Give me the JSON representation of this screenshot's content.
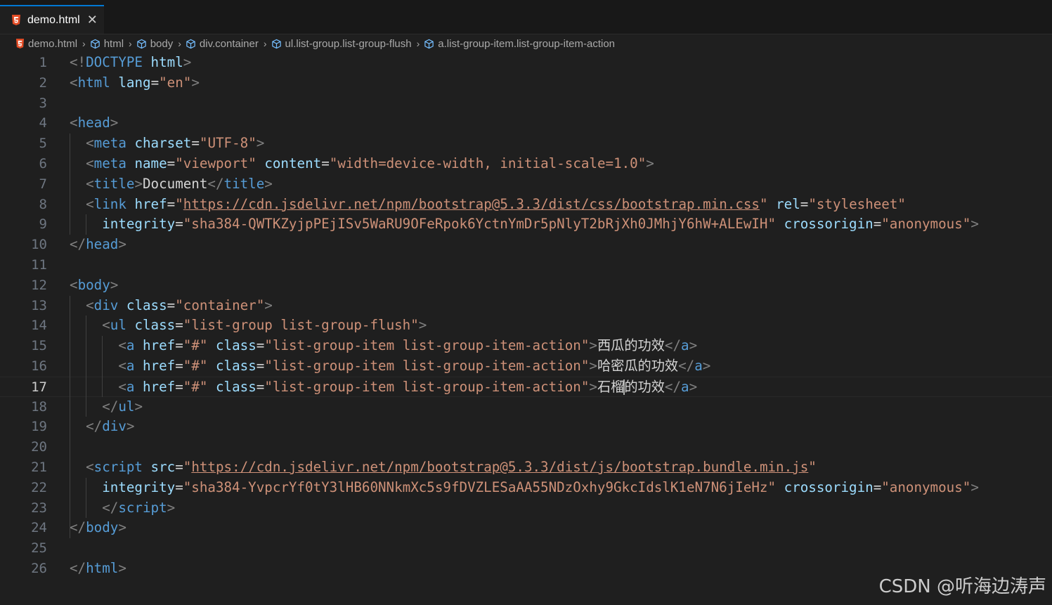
{
  "tab": {
    "filename": "demo.html",
    "close": "✕"
  },
  "breadcrumbs": [
    "demo.html",
    "html",
    "body",
    "div.container",
    "ul.list-group.list-group-flush",
    "a.list-group-item.list-group-item-action"
  ],
  "editor": {
    "active_line": 17,
    "line_numbers": [
      "1",
      "2",
      "3",
      "4",
      "5",
      "6",
      "7",
      "8",
      "9",
      "10",
      "11",
      "12",
      "13",
      "14",
      "15",
      "16",
      "17",
      "18",
      "19",
      "20",
      "21",
      "22",
      "23",
      "24",
      "25",
      "26"
    ],
    "lines": [
      [
        [
          "p",
          "<!"
        ],
        [
          "t",
          "DOCTYPE"
        ],
        [
          "x",
          " "
        ],
        [
          "a",
          "html"
        ],
        [
          "p",
          ">"
        ]
      ],
      [
        [
          "p",
          "<"
        ],
        [
          "t",
          "html"
        ],
        [
          "x",
          " "
        ],
        [
          "a",
          "lang"
        ],
        [
          "x",
          "="
        ],
        [
          "s",
          "\"en\""
        ],
        [
          "p",
          ">"
        ]
      ],
      [],
      [
        [
          "p",
          "<"
        ],
        [
          "t",
          "head"
        ],
        [
          "p",
          ">"
        ]
      ],
      [
        [
          "x",
          "  "
        ],
        [
          "p",
          "<"
        ],
        [
          "t",
          "meta"
        ],
        [
          "x",
          " "
        ],
        [
          "a",
          "charset"
        ],
        [
          "x",
          "="
        ],
        [
          "s",
          "\"UTF-8\""
        ],
        [
          "p",
          ">"
        ]
      ],
      [
        [
          "x",
          "  "
        ],
        [
          "p",
          "<"
        ],
        [
          "t",
          "meta"
        ],
        [
          "x",
          " "
        ],
        [
          "a",
          "name"
        ],
        [
          "x",
          "="
        ],
        [
          "s",
          "\"viewport\""
        ],
        [
          "x",
          " "
        ],
        [
          "a",
          "content"
        ],
        [
          "x",
          "="
        ],
        [
          "s",
          "\"width=device-width, initial-scale=1.0\""
        ],
        [
          "p",
          ">"
        ]
      ],
      [
        [
          "x",
          "  "
        ],
        [
          "p",
          "<"
        ],
        [
          "t",
          "title"
        ],
        [
          "p",
          ">"
        ],
        [
          "x",
          "Document"
        ],
        [
          "p",
          "</"
        ],
        [
          "t",
          "title"
        ],
        [
          "p",
          ">"
        ]
      ],
      [
        [
          "x",
          "  "
        ],
        [
          "p",
          "<"
        ],
        [
          "t",
          "link"
        ],
        [
          "x",
          " "
        ],
        [
          "a",
          "href"
        ],
        [
          "x",
          "="
        ],
        [
          "s",
          "\""
        ],
        [
          "u",
          "https://cdn.jsdelivr.net/npm/bootstrap@5.3.3/dist/css/bootstrap.min.css"
        ],
        [
          "s",
          "\""
        ],
        [
          "x",
          " "
        ],
        [
          "a",
          "rel"
        ],
        [
          "x",
          "="
        ],
        [
          "s",
          "\"stylesheet\""
        ]
      ],
      [
        [
          "x",
          "    "
        ],
        [
          "a",
          "integrity"
        ],
        [
          "x",
          "="
        ],
        [
          "s",
          "\"sha384-QWTKZyjpPEjISv5WaRU9OFeRpok6YctnYmDr5pNlyT2bRjXh0JMhjY6hW+ALEwIH\""
        ],
        [
          "x",
          " "
        ],
        [
          "a",
          "crossorigin"
        ],
        [
          "x",
          "="
        ],
        [
          "s",
          "\"anonymous\""
        ],
        [
          "p",
          ">"
        ]
      ],
      [
        [
          "p",
          "</"
        ],
        [
          "t",
          "head"
        ],
        [
          "p",
          ">"
        ]
      ],
      [],
      [
        [
          "p",
          "<"
        ],
        [
          "t",
          "body"
        ],
        [
          "p",
          ">"
        ]
      ],
      [
        [
          "x",
          "  "
        ],
        [
          "p",
          "<"
        ],
        [
          "t",
          "div"
        ],
        [
          "x",
          " "
        ],
        [
          "a",
          "class"
        ],
        [
          "x",
          "="
        ],
        [
          "s",
          "\"container\""
        ],
        [
          "p",
          ">"
        ]
      ],
      [
        [
          "x",
          "    "
        ],
        [
          "p",
          "<"
        ],
        [
          "t",
          "ul"
        ],
        [
          "x",
          " "
        ],
        [
          "a",
          "class"
        ],
        [
          "x",
          "="
        ],
        [
          "s",
          "\"list-group list-group-flush\""
        ],
        [
          "p",
          ">"
        ]
      ],
      [
        [
          "x",
          "      "
        ],
        [
          "p",
          "<"
        ],
        [
          "t",
          "a"
        ],
        [
          "x",
          " "
        ],
        [
          "a",
          "href"
        ],
        [
          "x",
          "="
        ],
        [
          "s",
          "\"#\""
        ],
        [
          "x",
          " "
        ],
        [
          "a",
          "class"
        ],
        [
          "x",
          "="
        ],
        [
          "s",
          "\"list-group-item list-group-item-action\""
        ],
        [
          "p",
          ">"
        ],
        [
          "x",
          "西瓜的功效"
        ],
        [
          "p",
          "</"
        ],
        [
          "t",
          "a"
        ],
        [
          "p",
          ">"
        ]
      ],
      [
        [
          "x",
          "      "
        ],
        [
          "p",
          "<"
        ],
        [
          "t",
          "a"
        ],
        [
          "x",
          " "
        ],
        [
          "a",
          "href"
        ],
        [
          "x",
          "="
        ],
        [
          "s",
          "\"#\""
        ],
        [
          "x",
          " "
        ],
        [
          "a",
          "class"
        ],
        [
          "x",
          "="
        ],
        [
          "s",
          "\"list-group-item list-group-item-action\""
        ],
        [
          "p",
          ">"
        ],
        [
          "x",
          "哈密瓜的功效"
        ],
        [
          "p",
          "</"
        ],
        [
          "t",
          "a"
        ],
        [
          "p",
          ">"
        ]
      ],
      [
        [
          "x",
          "      "
        ],
        [
          "p",
          "<"
        ],
        [
          "t",
          "a"
        ],
        [
          "x",
          " "
        ],
        [
          "a",
          "href"
        ],
        [
          "x",
          "="
        ],
        [
          "s",
          "\"#\""
        ],
        [
          "x",
          " "
        ],
        [
          "a",
          "class"
        ],
        [
          "x",
          "="
        ],
        [
          "s",
          "\"list-group-item list-group-item-action\""
        ],
        [
          "p",
          ">"
        ],
        [
          "x",
          "石榴"
        ],
        [
          "cursor",
          ""
        ],
        [
          "x",
          "的功效"
        ],
        [
          "p",
          "</"
        ],
        [
          "t",
          "a"
        ],
        [
          "p",
          ">"
        ]
      ],
      [
        [
          "x",
          "    "
        ],
        [
          "p",
          "</"
        ],
        [
          "t",
          "ul"
        ],
        [
          "p",
          ">"
        ]
      ],
      [
        [
          "x",
          "  "
        ],
        [
          "p",
          "</"
        ],
        [
          "t",
          "div"
        ],
        [
          "p",
          ">"
        ]
      ],
      [],
      [
        [
          "x",
          "  "
        ],
        [
          "p",
          "<"
        ],
        [
          "t",
          "script"
        ],
        [
          "x",
          " "
        ],
        [
          "a",
          "src"
        ],
        [
          "x",
          "="
        ],
        [
          "s",
          "\""
        ],
        [
          "u",
          "https://cdn.jsdelivr.net/npm/bootstrap@5.3.3/dist/js/bootstrap.bundle.min.js"
        ],
        [
          "s",
          "\""
        ]
      ],
      [
        [
          "x",
          "    "
        ],
        [
          "a",
          "integrity"
        ],
        [
          "x",
          "="
        ],
        [
          "s",
          "\"sha384-YvpcrYf0tY3lHB60NNkmXc5s9fDVZLESaAA55NDzOxhy9GkcIdslK1eN7N6jIeHz\""
        ],
        [
          "x",
          " "
        ],
        [
          "a",
          "crossorigin"
        ],
        [
          "x",
          "="
        ],
        [
          "s",
          "\"anonymous\""
        ],
        [
          "p",
          ">"
        ]
      ],
      [
        [
          "x",
          "    "
        ],
        [
          "p",
          "</"
        ],
        [
          "t",
          "script"
        ],
        [
          "p",
          ">"
        ]
      ],
      [
        [
          "p",
          "</"
        ],
        [
          "t",
          "body"
        ],
        [
          "p",
          ">"
        ]
      ],
      [],
      [
        [
          "p",
          "</"
        ],
        [
          "t",
          "html"
        ],
        [
          "p",
          ">"
        ]
      ]
    ]
  },
  "watermark": "CSDN @听海边涛声",
  "colors": {
    "tag": "#569cd6",
    "attribute": "#9cdcfe",
    "string": "#ce9178",
    "punctuation": "#808080",
    "text": "#d4d4d4",
    "accent": "#0078d4",
    "html5_icon": "#e44d26"
  }
}
